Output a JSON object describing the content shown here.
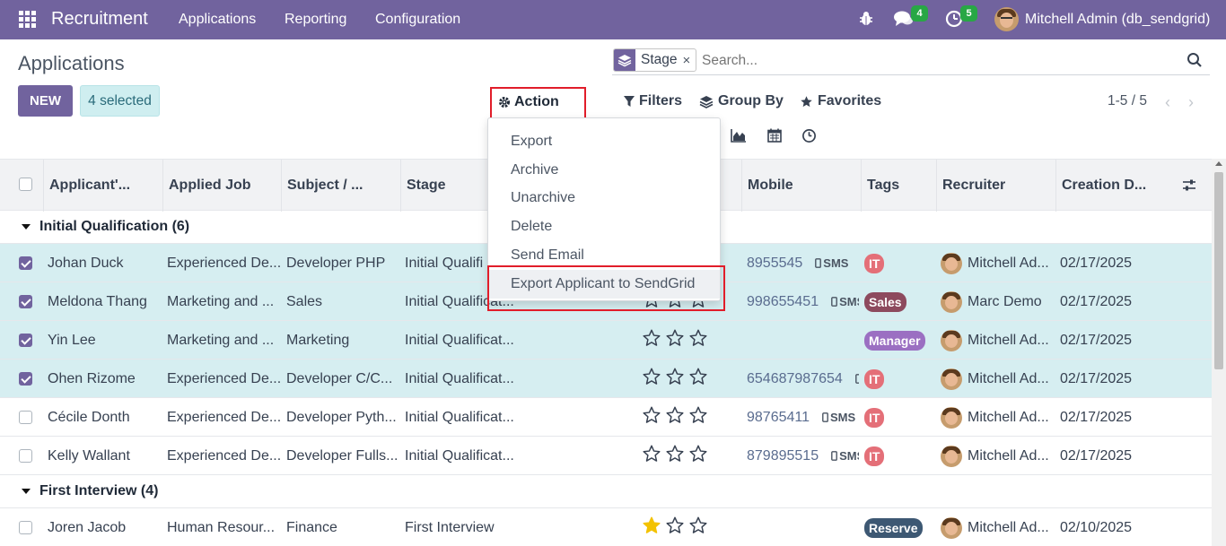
{
  "navbar": {
    "app_name": "Recruitment",
    "menu": [
      "Applications",
      "Reporting",
      "Configuration"
    ],
    "messages_badge": "4",
    "activities_badge": "5",
    "user_name": "Mitchell Admin (db_sendgrid)"
  },
  "control_panel": {
    "title": "Applications",
    "new_label": "NEW",
    "selected_label": "4 selected",
    "action_label": "Action",
    "search": {
      "facet_label": "Stage",
      "facet_remove": "×",
      "placeholder": "Search..."
    },
    "filters_label": "Filters",
    "group_by_label": "Group By",
    "favorites_label": "Favorites",
    "pager": "1-5 / 5"
  },
  "action_menu": {
    "items": [
      "Export",
      "Archive",
      "Unarchive",
      "Delete",
      "Send Email",
      "Export Applicant to SendGrid"
    ]
  },
  "table": {
    "headers": [
      "Applicant'...",
      "Applied Job",
      "Subject / ...",
      "Stage",
      "Mobile",
      "Tags",
      "Recruiter",
      "Creation D..."
    ],
    "groups": [
      {
        "label": "Initial Qualification (6)",
        "rows": [
          {
            "selected": true,
            "applicant": "Johan Duck",
            "job": "Experienced De...",
            "subject": "Developer PHP",
            "stage": "Initial Qualifi",
            "stars": 0,
            "mobile": "8955545",
            "sms": "SMS",
            "tag": "IT",
            "tag_color": "#e46f78",
            "recruiter": "Mitchell Ad...",
            "date": "02/17/2025"
          },
          {
            "selected": true,
            "applicant": "Meldona Thang",
            "job": "Marketing and ...",
            "subject": "Sales",
            "stage": "Initial Qualificat...",
            "stars": 0,
            "mobile": "998655451",
            "sms": "SMS",
            "tag": "Sales",
            "tag_color": "#8d4a5e",
            "recruiter": "Marc Demo",
            "date": "02/17/2025"
          },
          {
            "selected": true,
            "applicant": "Yin Lee",
            "job": "Marketing and ...",
            "subject": "Marketing",
            "stage": "Initial Qualificat...",
            "stars": 0,
            "mobile": "",
            "sms": "",
            "tag": "Manager",
            "tag_color": "#9b6fc2",
            "recruiter": "Mitchell Ad...",
            "date": "02/17/2025"
          },
          {
            "selected": true,
            "applicant": "Ohen Rizome",
            "job": "Experienced De...",
            "subject": "Developer C/C...",
            "stage": "Initial Qualificat...",
            "stars": 0,
            "mobile": "654687987654",
            "sms": "",
            "tag": "IT",
            "tag_color": "#e46f78",
            "recruiter": "Mitchell Ad...",
            "date": "02/17/2025"
          },
          {
            "selected": false,
            "applicant": "Cécile Donth",
            "job": "Experienced De...",
            "subject": "Developer Pyth...",
            "stage": "Initial Qualificat...",
            "stars": 0,
            "mobile": "98765411",
            "sms": "SMS",
            "tag": "IT",
            "tag_color": "#e46f78",
            "recruiter": "Mitchell Ad...",
            "date": "02/17/2025"
          },
          {
            "selected": false,
            "applicant": "Kelly Wallant",
            "job": "Experienced De...",
            "subject": "Developer Fulls...",
            "stage": "Initial Qualificat...",
            "stars": 0,
            "mobile": "879895515",
            "sms": "SMS",
            "tag": "IT",
            "tag_color": "#e46f78",
            "recruiter": "Mitchell Ad...",
            "date": "02/17/2025"
          }
        ]
      },
      {
        "label": "First Interview (4)",
        "rows": [
          {
            "selected": false,
            "applicant": "Joren Jacob",
            "job": "Human Resour...",
            "subject": "Finance",
            "stage": "First Interview",
            "stars": 1,
            "mobile": "",
            "sms": "",
            "tag": "Reserve",
            "tag_color": "#3d5873",
            "recruiter": "Mitchell Ad...",
            "date": "02/10/2025"
          }
        ]
      }
    ]
  },
  "colors": {
    "brand": "#71639e",
    "selected_row": "#d6eef1",
    "highlight_box": "#e11d2a",
    "star_filled": "#f3c200"
  }
}
